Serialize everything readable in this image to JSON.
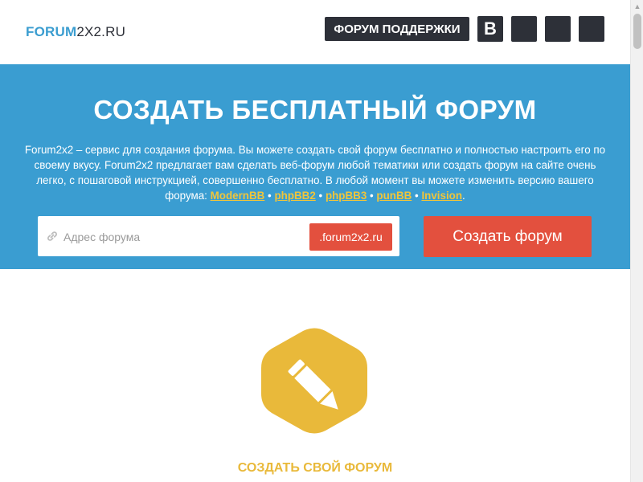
{
  "header": {
    "logo_bold": "FORUM",
    "logo_rest": "2X2.RU",
    "support_label": "ФОРУМ ПОДДЕРЖКИ",
    "social": [
      {
        "icon": "vk-icon",
        "glyph": "B"
      },
      {
        "icon": "social-icon"
      },
      {
        "icon": "social-icon"
      },
      {
        "icon": "social-icon"
      }
    ]
  },
  "hero": {
    "title": "СОЗДАТЬ БЕСПЛАТНЫЙ ФОРУМ",
    "description": "Forum2x2 – сервис для создания форума. Вы можете создать свой форум бесплатно и полностью настроить его по своему вкусу. Forum2x2 предлагает вам сделать веб-форум любой тематики или создать форум на сайте очень легко, с пошаговой инструкцией, совершенно бесплатно. В любой момент вы можете изменить версию вашего форума:",
    "versions": [
      "ModernBB",
      "phpBB2",
      "phpBB3",
      "punBB",
      "Invision"
    ],
    "separator": " • ",
    "end": ".",
    "address_placeholder": "Адрес форума",
    "domain_suffix": ".forum2x2.ru",
    "create_button": "Создать форум"
  },
  "feature": {
    "icon": "pencil-icon",
    "title": "СОЗДАТЬ СВОЙ ФОРУМ"
  },
  "colors": {
    "brand_blue": "#3a9dd1",
    "accent_red": "#e3503e",
    "link_yellow": "#f0c53a",
    "hex_yellow": "#e9b93a",
    "dark": "#2d3038"
  }
}
